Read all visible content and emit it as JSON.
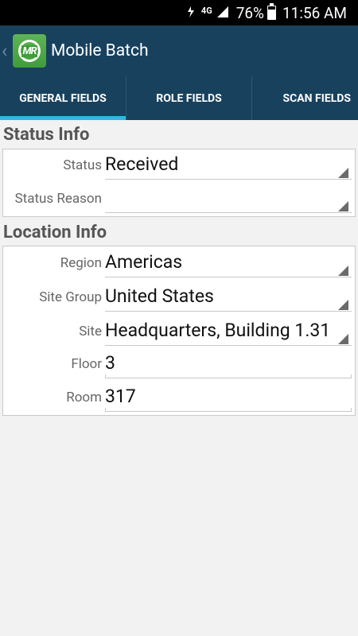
{
  "status_bar": {
    "network": "4G",
    "battery": "76%",
    "time": "11:56 AM"
  },
  "app": {
    "title": "Mobile Batch",
    "logo_text": "MR"
  },
  "tabs": [
    {
      "label": "GENERAL FIELDS",
      "active": true
    },
    {
      "label": "ROLE FIELDS",
      "active": false
    },
    {
      "label": "SCAN FIELDS",
      "active": false
    }
  ],
  "status_info": {
    "title": "Status Info",
    "fields": [
      {
        "label": "Status",
        "value": "Received",
        "type": "dropdown"
      },
      {
        "label": "Status Reason",
        "value": "",
        "type": "dropdown"
      }
    ]
  },
  "location_info": {
    "title": "Location Info",
    "fields": [
      {
        "label": "Region",
        "value": "Americas",
        "type": "dropdown"
      },
      {
        "label": "Site Group",
        "value": "United States",
        "type": "dropdown"
      },
      {
        "label": "Site",
        "value": "Headquarters, Building 1.31",
        "type": "dropdown"
      },
      {
        "label": "Floor",
        "value": "3",
        "type": "text"
      },
      {
        "label": "Room",
        "value": "317",
        "type": "text"
      }
    ]
  },
  "colors": {
    "header": "#18415e",
    "tab_indicator": "#33b5e5",
    "logo_green": "#4caf50"
  }
}
